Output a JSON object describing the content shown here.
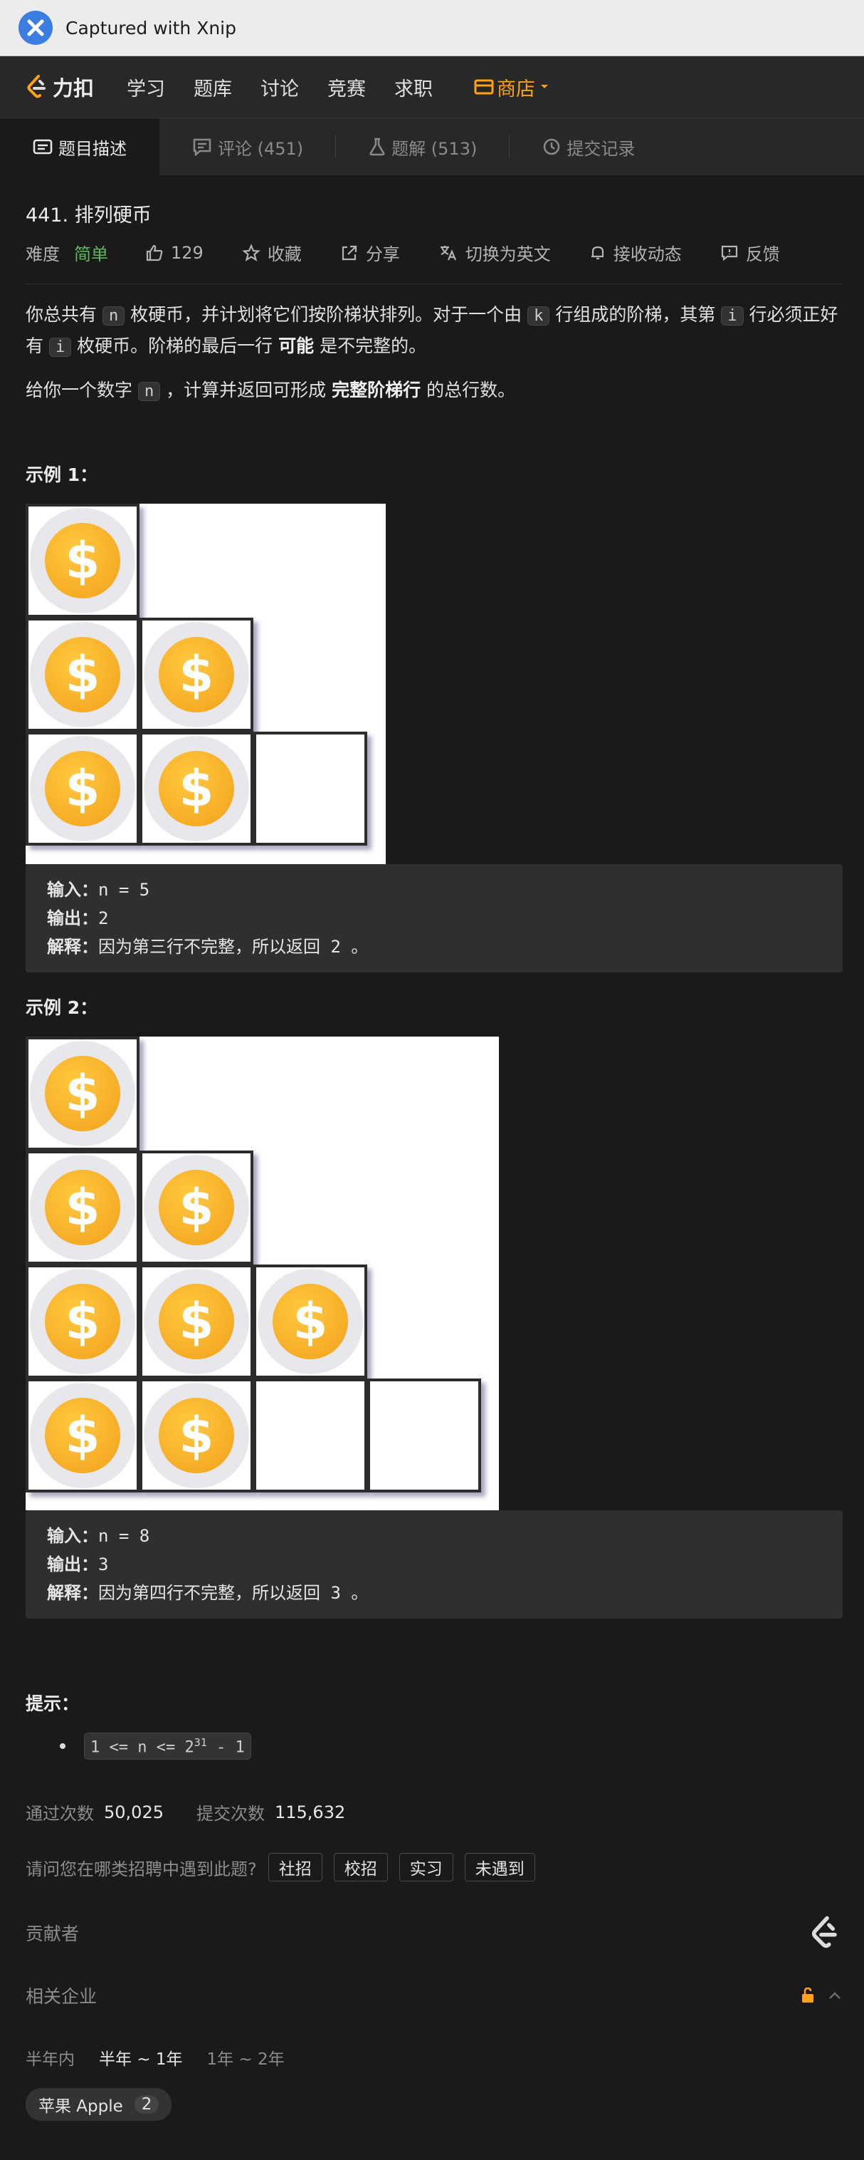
{
  "titlebar": {
    "title": "Captured with Xnip",
    "logo_icon": "xnip-logo-icon"
  },
  "nav": {
    "brand": "力扣",
    "items": [
      "学习",
      "题库",
      "讨论",
      "竞赛",
      "求职"
    ],
    "store": "商店",
    "accent": "#ffa116"
  },
  "tabs": {
    "description": "题目描述",
    "comments": "评论 (451)",
    "solutions": "题解 (513)",
    "submissions": "提交记录"
  },
  "problem": {
    "title": "441. 排列硬币",
    "difficulty_label": "难度",
    "difficulty": "简单",
    "difficulty_color": "#5cb85c",
    "likes": "129",
    "favorite": "收藏",
    "share": "分享",
    "switch_lang": "切换为英文",
    "notify": "接收动态",
    "feedback": "反馈"
  },
  "desc": {
    "p1_a": "你总共有",
    "n": "n",
    "p1_b": "枚硬币，并计划将它们按阶梯状排列。对于一个由",
    "k": "k",
    "p1_c": "行组成的阶梯，其第",
    "i": "i",
    "p1_d": "行必须正好有",
    "p1_e": "枚硬币。阶梯的最后一行",
    "p1_bold": "可能",
    "p1_f": "是不完整的。",
    "p2_a": "给你一个数字",
    "p2_b": "，计算并返回可形成",
    "p2_bold": "完整阶梯行",
    "p2_c": "的总行数。"
  },
  "example1": {
    "title": "示例 1：",
    "coin_symbol": "$",
    "input_label": "输入：",
    "input": "n = 5",
    "output_label": "输出：",
    "output": "2",
    "explain_label": "解释：",
    "explain": "因为第三行不完整，所以返回 2 。"
  },
  "example2": {
    "title": "示例 2：",
    "input_label": "输入：",
    "input": "n = 8",
    "output_label": "输出：",
    "output": "3",
    "explain_label": "解释：",
    "explain": "因为第四行不完整，所以返回 3 。"
  },
  "hints": {
    "title": "提示：",
    "c1": "1 <= n <= 2",
    "c_exp": "31",
    "c2": " - 1"
  },
  "stats": {
    "accepted_label": "通过次数",
    "accepted": "50,025",
    "submitted_label": "提交次数",
    "submitted": "115,632"
  },
  "poll": {
    "question": "请问您在哪类招聘中遇到此题?",
    "options": [
      "社招",
      "校招",
      "实习",
      "未遇到"
    ]
  },
  "contributors": {
    "label": "贡献者"
  },
  "companies": {
    "label": "相关企业",
    "periods": [
      "半年内",
      "半年 ~ 1年",
      "1年 ~ 2年"
    ],
    "tag_name": "苹果 Apple",
    "tag_count": "2"
  }
}
